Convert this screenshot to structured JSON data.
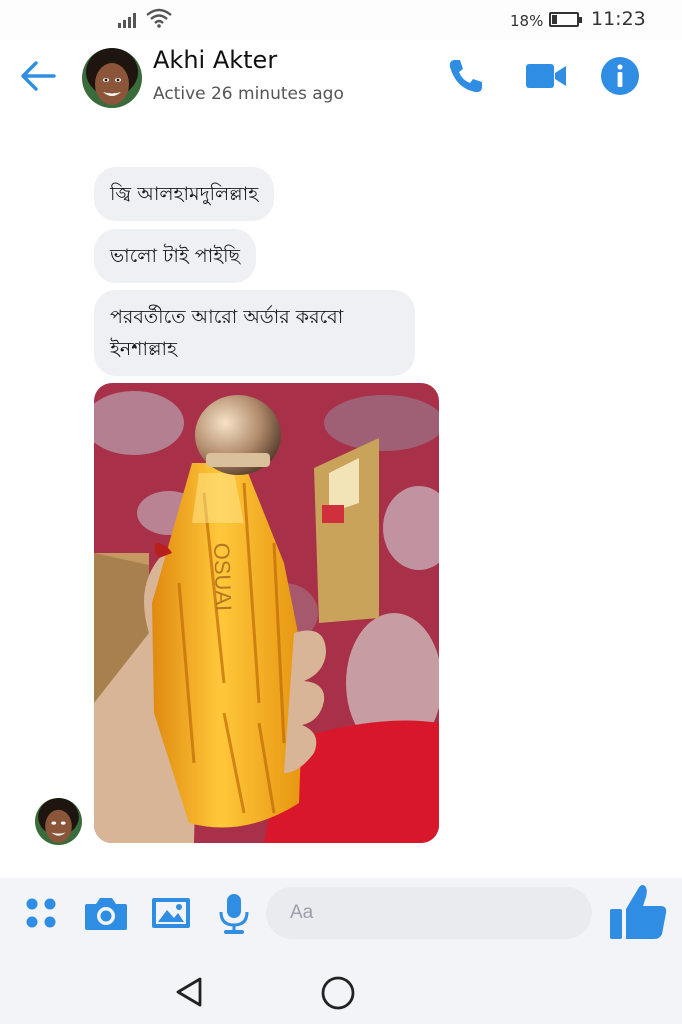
{
  "status_bar": {
    "battery_percent": "18%",
    "battery_level": 0.18,
    "time": "11:23"
  },
  "header": {
    "contact_name": "Akhi Akter",
    "status": "Active 26 minutes ago"
  },
  "icons": {
    "back": "arrow-left-icon",
    "call": "phone-icon",
    "video": "video-camera-icon",
    "info": "info-icon",
    "more": "four-dots-icon",
    "camera": "camera-icon",
    "gallery": "image-icon",
    "voice": "microphone-icon",
    "like": "thumbs-up-icon",
    "nav_back": "triangle-back-icon",
    "nav_home": "circle-home-icon"
  },
  "messages": [
    {
      "text": "জ্বি আলহামদুলিল্লাহ"
    },
    {
      "text": "ভালো টাই পাইছি"
    },
    {
      "text": "পরবর্তীতে আরো অর্ডার করবো ইনশাল্লাহ"
    }
  ],
  "photo": {
    "bottle_text": "OSUAI"
  },
  "composer": {
    "placeholder": "Aa"
  },
  "colors": {
    "accent": "#2f8de4",
    "bubble": "#eef0f4",
    "background": "#f2f4f7"
  }
}
